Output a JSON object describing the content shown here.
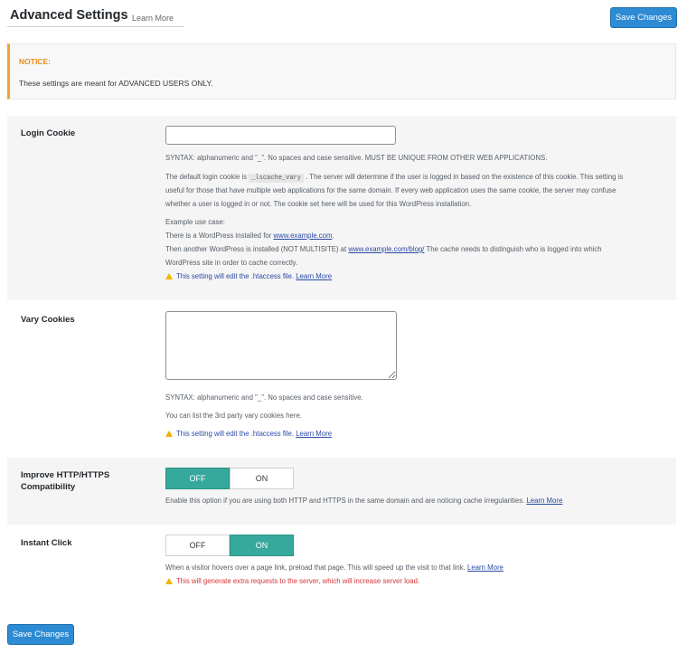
{
  "header": {
    "title": "Advanced Settings",
    "learn_more": "Learn More",
    "save_button": "Save Changes"
  },
  "notice": {
    "title": "NOTICE:",
    "text": "These settings are meant for ADVANCED USERS ONLY."
  },
  "login_cookie": {
    "label": "Login Cookie",
    "value": "",
    "syntax": "SYNTAX: alphanumeric and \"_\". No spaces and case sensitive. MUST BE UNIQUE FROM OTHER WEB APPLICATIONS.",
    "desc_pre": "The default login cookie is",
    "desc_code": "_lscache_vary",
    "desc_post": ". The server will determine if the user is logged in based on the existence of this cookie. This setting is",
    "desc_line2": "useful for those that have multiple web applications for the same domain. If every web application uses the same cookie, the server may confuse",
    "desc_line3": "whether a user is logged in or not. The cookie set here will be used for this WordPress installation.",
    "example_title": "Example use case:",
    "example_line1_pre": "There is a WordPress installed for",
    "example_line1_link": "www.example.com",
    "example_line1_post": ".",
    "example_line2_pre": "Then another WordPress is installed (NOT MULTISITE) at",
    "example_line2_link": "www.example.com/blog/",
    "example_line2_post": "The cache needs to distinguish who is logged into which",
    "example_line3": "WordPress site in order to cache correctly.",
    "warning": "This setting will edit the .htaccess file.",
    "warning_link": "Learn More"
  },
  "vary_cookies": {
    "label": "Vary Cookies",
    "value": "",
    "syntax": "SYNTAX: alphanumeric and \"_\". No spaces and case sensitive.",
    "desc": "You can list the 3rd party vary cookies here.",
    "warning": "This setting will edit the .htaccess file.",
    "warning_link": "Learn More"
  },
  "http_https": {
    "label_line1": "Improve HTTP/HTTPS",
    "label_line2": "Compatibility",
    "off": "OFF",
    "on": "ON",
    "state": "OFF",
    "desc": "Enable this option if you are using both HTTP and HTTPS in the same domain and are noticing cache irregularities.",
    "desc_link": "Learn More"
  },
  "instant_click": {
    "label": "Instant Click",
    "off": "OFF",
    "on": "ON",
    "state": "ON",
    "desc": "When a visitor hovers over a page link, preload that page. This will speed up the visit to that link.",
    "desc_link": "Learn More",
    "warning": "This will generate extra requests to the server, which will increase server load."
  },
  "footer": {
    "save_button": "Save Changes"
  },
  "colors": {
    "primary_button": "#2d8bd4",
    "toggle_active": "#36a99c",
    "notice_accent": "#f0a530",
    "warning_red": "#d63638",
    "link": "#2b4aa5"
  },
  "icons": {
    "warning": "warning-triangle-icon"
  }
}
